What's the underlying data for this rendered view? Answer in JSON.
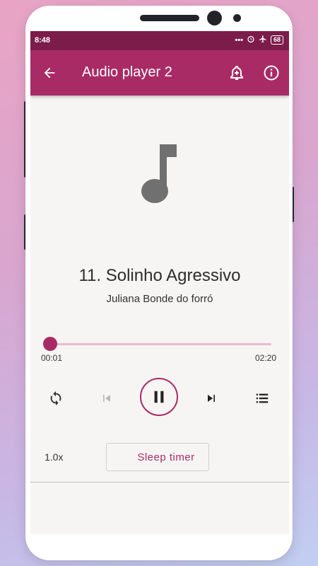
{
  "status_bar": {
    "time": "8:48",
    "battery": "68"
  },
  "app_bar": {
    "title": "Audio player 2"
  },
  "track": {
    "title": "11. Solinho Agressivo",
    "artist": "Juliana Bonde do forró"
  },
  "progress": {
    "current": "00:01",
    "total": "02:20",
    "fraction": 0.007
  },
  "controls": {
    "speed": "1.0x",
    "sleep_timer_label": "Sleep timer"
  },
  "colors": {
    "status_bar": "#7c1c4b",
    "app_bar": "#a82b66",
    "accent": "#a82b66",
    "background": "#f7f5f4"
  },
  "icons": [
    "back-arrow-icon",
    "add-alarm-icon",
    "info-icon",
    "music-note-icon",
    "repeat-icon",
    "skip-previous-icon",
    "pause-icon",
    "skip-next-icon",
    "playlist-icon",
    "moon-icon"
  ]
}
